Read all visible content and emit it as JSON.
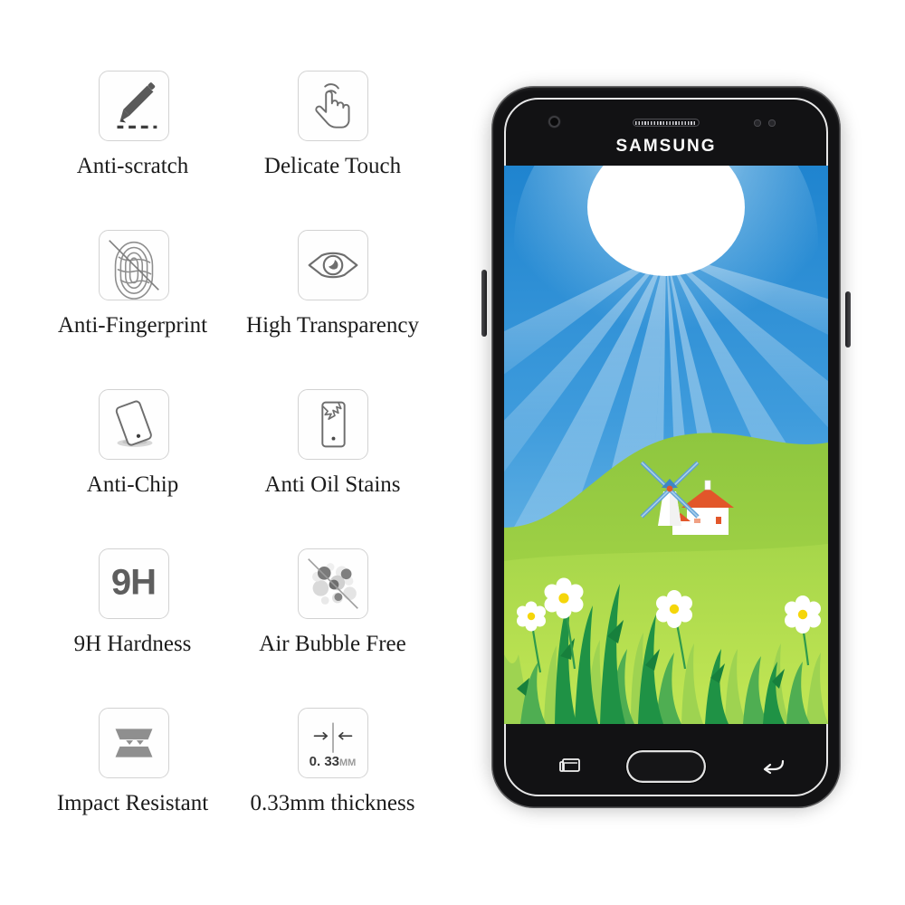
{
  "product": {
    "brand": "SAMSUNG",
    "type": "tempered-glass-screen-protector-feature-sheet"
  },
  "features": [
    {
      "icon": "pen-scratch-icon",
      "label": "Anti-scratch"
    },
    {
      "icon": "touch-hand-icon",
      "label": "Delicate Touch"
    },
    {
      "icon": "fingerprint-slash-icon",
      "label": "Anti-Fingerprint"
    },
    {
      "icon": "eye-icon",
      "label": "High Transparency"
    },
    {
      "icon": "phone-tilt-icon",
      "label": "Anti-Chip"
    },
    {
      "icon": "phone-crack-icon",
      "label": "Anti Oil Stains"
    },
    {
      "icon": "hardness-9h-icon",
      "label": "9H Hardness"
    },
    {
      "icon": "bubbles-slash-icon",
      "label": "Air Bubble Free"
    },
    {
      "icon": "layers-impact-icon",
      "label": "Impact Resistant"
    },
    {
      "icon": "thickness-arrows-icon",
      "label": "0.33mm thickness"
    }
  ],
  "icon_text": {
    "hardness": "9H",
    "thickness_value": "0. 33",
    "thickness_unit": "MM"
  },
  "phone": {
    "brand_label": "SAMSUNG",
    "hardware": {
      "front_camera": "front-camera-icon",
      "earpiece": "earpiece-speaker-icon",
      "proximity_sensor": "proximity-sensor-icon",
      "light_sensor": "light-sensor-icon",
      "home_button": "home-button",
      "recents_button": "recents-icon",
      "back_button": "back-arrow-icon",
      "volume_key": "volume-key",
      "power_key": "power-key"
    },
    "wallpaper": {
      "scene": "sunburst-meadow-windmill",
      "elements": [
        "sun",
        "sun-rays",
        "sky",
        "green-hill",
        "windmill",
        "farm-house",
        "grass",
        "daisies"
      ]
    }
  },
  "colors": {
    "sky_top": "#2487d0",
    "sky_bottom": "#7cc2ea",
    "sun": "#ffffff",
    "ray": "#67b4e4",
    "hill_top": "#8fc740",
    "hill_bottom": "#a8d94a",
    "meadow": "#b7e04f",
    "grass_dark": "#1f9245",
    "grass_light": "#8ccf4e",
    "roof": "#e2562a",
    "windmill_blade": "#5c9fd6",
    "daisy_center": "#f5d60a",
    "frame_dark": "#1b1b1d",
    "bezel_black": "#121214",
    "icon_border": "#d2d2d2",
    "icon_gray": "#6b6b6b",
    "label_text": "#1b1b1b"
  }
}
